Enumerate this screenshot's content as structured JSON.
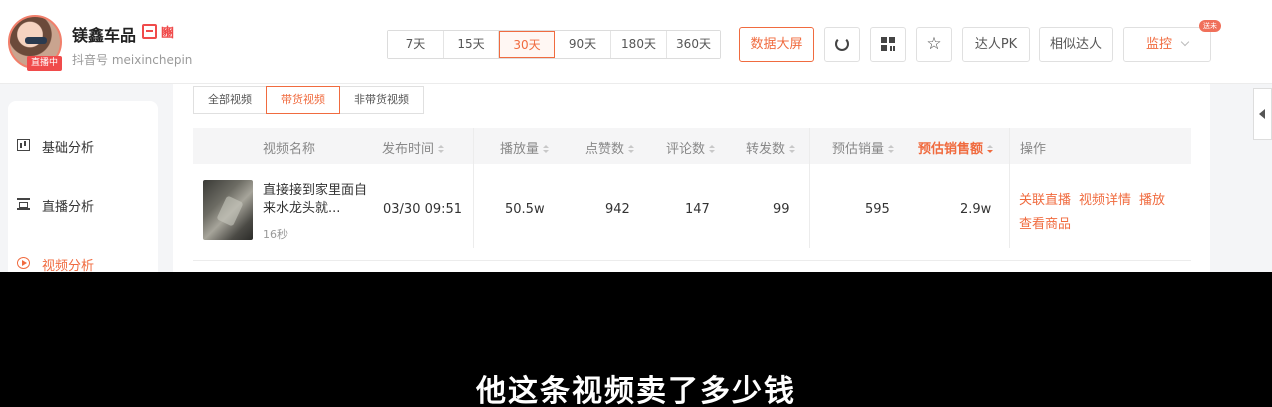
{
  "header": {
    "account_name": "镁鑫车品",
    "verify_mark": "豳",
    "account_id": "抖音号 meixinchepin",
    "live_badge": "直播中",
    "date_ranges": [
      "7天",
      "15天",
      "30天",
      "90天",
      "180天",
      "360天"
    ],
    "active_range": "30天",
    "big_screen_label": "数据大屏",
    "refresh_icon": "refresh-icon",
    "qr_icon": "qr-code-icon",
    "star_icon": "star-icon",
    "pk_label": "达人PK",
    "similar_label": "相似达人",
    "monitor_label": "监控",
    "new_tag": "送未"
  },
  "sidebar": {
    "items": [
      {
        "label": "基础分析",
        "icon": "bar-chart-icon"
      },
      {
        "label": "直播分析",
        "icon": "live-icon"
      },
      {
        "label": "视频分析",
        "icon": "play-icon"
      }
    ]
  },
  "filters": [
    "全部视频",
    "带货视频",
    "非带货视频"
  ],
  "active_filter": "带货视频",
  "table": {
    "headers": {
      "name": "视频名称",
      "time": "发布时间",
      "plays": "播放量",
      "likes": "点赞数",
      "comments": "评论数",
      "shares": "转发数",
      "est_sales": "预估销量",
      "est_revenue": "预估销售额",
      "ops": "操作"
    },
    "rows": [
      {
        "title": "直接接到家里面自来水龙头就...",
        "duration": "16秒",
        "time": "03/30 09:51",
        "plays": "50.5w",
        "likes": "942",
        "comments": "147",
        "shares": "99",
        "est_sales": "595",
        "est_revenue": "2.9w",
        "ops": [
          "关联直播",
          "视频详情",
          "播放",
          "查看商品"
        ]
      }
    ]
  },
  "subtitle": "他这条视频卖了多少钱",
  "colors": {
    "accent": "#f06b3f",
    "live_red": "#f04b4b"
  }
}
